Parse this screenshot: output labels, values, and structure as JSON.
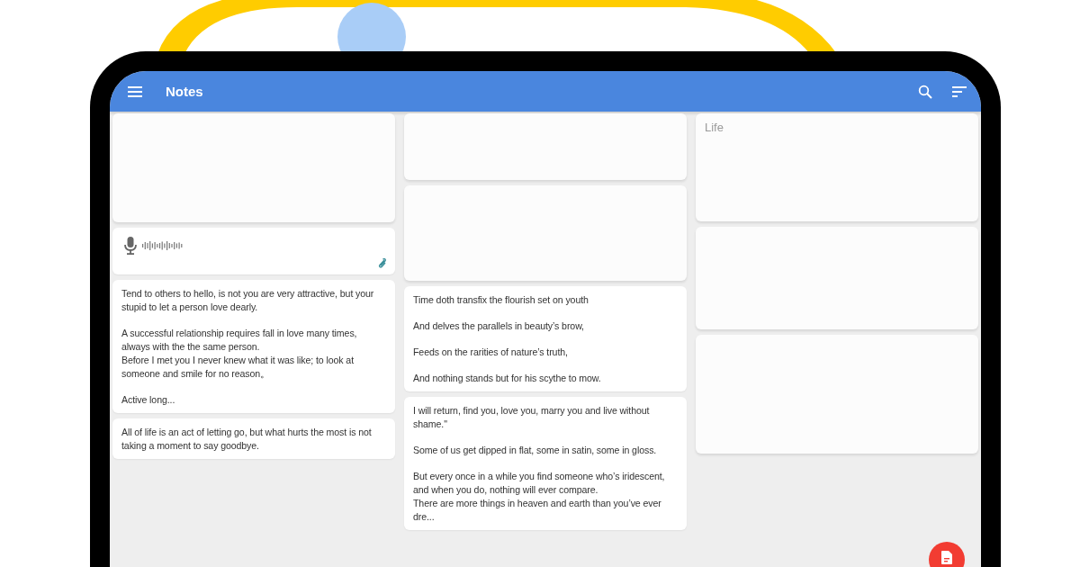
{
  "app_bar": {
    "title": "Notes"
  },
  "columns": [
    [
      {
        "kind": "faded"
      },
      {
        "kind": "audio"
      },
      {
        "kind": "text",
        "paragraphs": [
          [
            "Tend to others to hello, is not you are very attractive, but your stupid to let a person love dearly."
          ],
          [
            "A successful relationship requires fall in love many times, always with the the same person.",
            "Before I met you I never knew what it was like; to look at someone and smile for no reason。"
          ],
          [
            "Active long..."
          ]
        ]
      },
      {
        "kind": "text",
        "paragraphs": [
          [
            "All of life is an act of letting go, but what hurts the most is not taking a moment to say goodbye."
          ]
        ]
      }
    ],
    [
      {
        "kind": "faded"
      },
      {
        "kind": "faded"
      },
      {
        "kind": "text",
        "paragraphs": [
          [
            "Time doth transfix the flourish set on youth"
          ],
          [
            "And delves the parallels in beauty’s brow,"
          ],
          [
            "Feeds on the rarities of nature’s truth,"
          ],
          [
            "And nothing stands but for his scythe to mow."
          ]
        ]
      },
      {
        "kind": "text",
        "paragraphs": [
          [
            "I will return, find you, love you, marry you and live without shame.\""
          ],
          [
            "Some of us get dipped in flat, some in satin, some in gloss."
          ],
          [
            "But every once in a while you find someone who’s iridescent, and when you do, nothing will ever compare.",
            "There are more things in heaven and earth than you’ve ever dre..."
          ]
        ]
      }
    ],
    [
      {
        "kind": "faded",
        "title": "Life"
      },
      {
        "kind": "faded"
      },
      {
        "kind": "faded"
      }
    ]
  ]
}
